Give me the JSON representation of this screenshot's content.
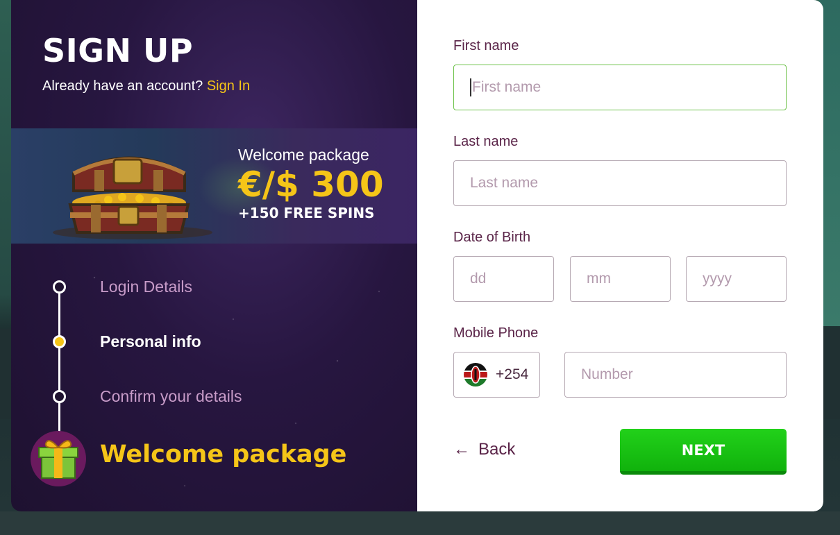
{
  "left": {
    "title": "SIGN UP",
    "have_account": "Already have an account?",
    "sign_in": "Sign In",
    "banner": {
      "subtitle": "Welcome package",
      "amount": "€/$ 300",
      "spins": "+150 FREE SPINS"
    },
    "steps": [
      {
        "label": "Login Details",
        "state": "done"
      },
      {
        "label": "Personal info",
        "state": "current"
      },
      {
        "label": "Confirm your details",
        "state": "pending"
      }
    ],
    "final_step": "Welcome package"
  },
  "form": {
    "first_name_label": "First name",
    "first_name_placeholder": "First name",
    "last_name_label": "Last name",
    "last_name_placeholder": "Last name",
    "dob_label": "Date of Birth",
    "dob_day_placeholder": "dd",
    "dob_month_placeholder": "mm",
    "dob_year_placeholder": "yyyy",
    "phone_label": "Mobile Phone",
    "phone_code": "+254",
    "phone_placeholder": "Number",
    "back_label": "Back",
    "next_label": "NEXT"
  },
  "colors": {
    "accent": "#f5c518",
    "label": "#5a2448",
    "next": "#10b20c",
    "focus_border": "#6ec24a"
  }
}
